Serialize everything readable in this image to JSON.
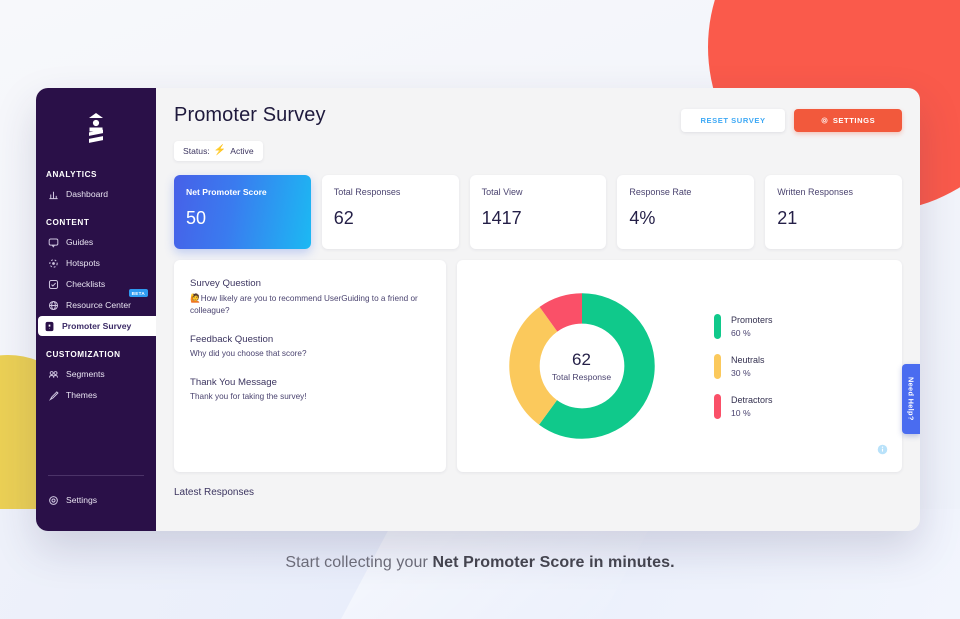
{
  "brand": {
    "logo_icon": "lighthouse-logo",
    "accent_blue": "#3fa9f5",
    "accent_orange": "#f2593c",
    "sidebar_bg": "#2a1048"
  },
  "sidebar": {
    "groups": [
      {
        "title": "ANALYTICS",
        "items": [
          {
            "label": "Dashboard",
            "icon": "chart-bar-icon",
            "active": false
          }
        ]
      },
      {
        "title": "CONTENT",
        "items": [
          {
            "label": "Guides",
            "icon": "chat-bubble-icon",
            "active": false
          },
          {
            "label": "Hotspots",
            "icon": "hotspot-icon",
            "active": false
          },
          {
            "label": "Checklists",
            "icon": "checkbox-icon",
            "active": false
          },
          {
            "label": "Resource Center",
            "icon": "globe-icon",
            "active": false,
            "badge": "BETA"
          },
          {
            "label": "Promoter Survey",
            "icon": "survey-icon",
            "active": true
          }
        ]
      },
      {
        "title": "CUSTOMIZATION",
        "items": [
          {
            "label": "Segments",
            "icon": "segments-icon",
            "active": false
          },
          {
            "label": "Themes",
            "icon": "brush-icon",
            "active": false
          }
        ]
      }
    ],
    "bottom": {
      "label": "Settings",
      "icon": "gear-icon"
    }
  },
  "header": {
    "title": "Promoter Survey",
    "reset_label": "RESET SURVEY",
    "settings_label": "SETTINGS",
    "settings_icon": "gear-icon",
    "status_label": "Status:",
    "status_icon": "lightning-bolt-icon",
    "status_value": "Active"
  },
  "stats": [
    {
      "label": "Net Promoter Score",
      "value": "50",
      "primary": true
    },
    {
      "label": "Total Responses",
      "value": "62",
      "primary": false
    },
    {
      "label": "Total View",
      "value": "1417",
      "primary": false
    },
    {
      "label": "Response Rate",
      "value": "4%",
      "primary": false
    },
    {
      "label": "Written Responses",
      "value": "21",
      "primary": false
    }
  ],
  "survey_panel": {
    "blocks": [
      {
        "title": "Survey Question",
        "emoji": "🙋",
        "body": "How likely are you to recommend UserGuiding to a friend or colleague?"
      },
      {
        "title": "Feedback Question",
        "emoji": "",
        "body": "Why did you choose that score?"
      },
      {
        "title": "Thank You Message",
        "emoji": "",
        "body": "Thank you for taking the survey!"
      }
    ]
  },
  "chart_data": {
    "type": "pie",
    "title": "",
    "center_value": "62",
    "center_caption": "Total Response",
    "legend_position": "right",
    "categories": [
      "Promoters",
      "Neutrals",
      "Detractors"
    ],
    "values": [
      60,
      30,
      10
    ],
    "value_labels": [
      "60 %",
      "30 %",
      "10 %"
    ],
    "colors": [
      "#10c98b",
      "#fbc95c",
      "#fa5068"
    ],
    "unit": "%",
    "donut_hole_ratio": 0.64,
    "info_icon": "info-circle-icon"
  },
  "latest_responses_label": "Latest Responses",
  "need_help": {
    "label": "Need Help?"
  },
  "caption": {
    "prefix": "Start collecting your ",
    "strong": "Net Promoter Score in minutes."
  }
}
